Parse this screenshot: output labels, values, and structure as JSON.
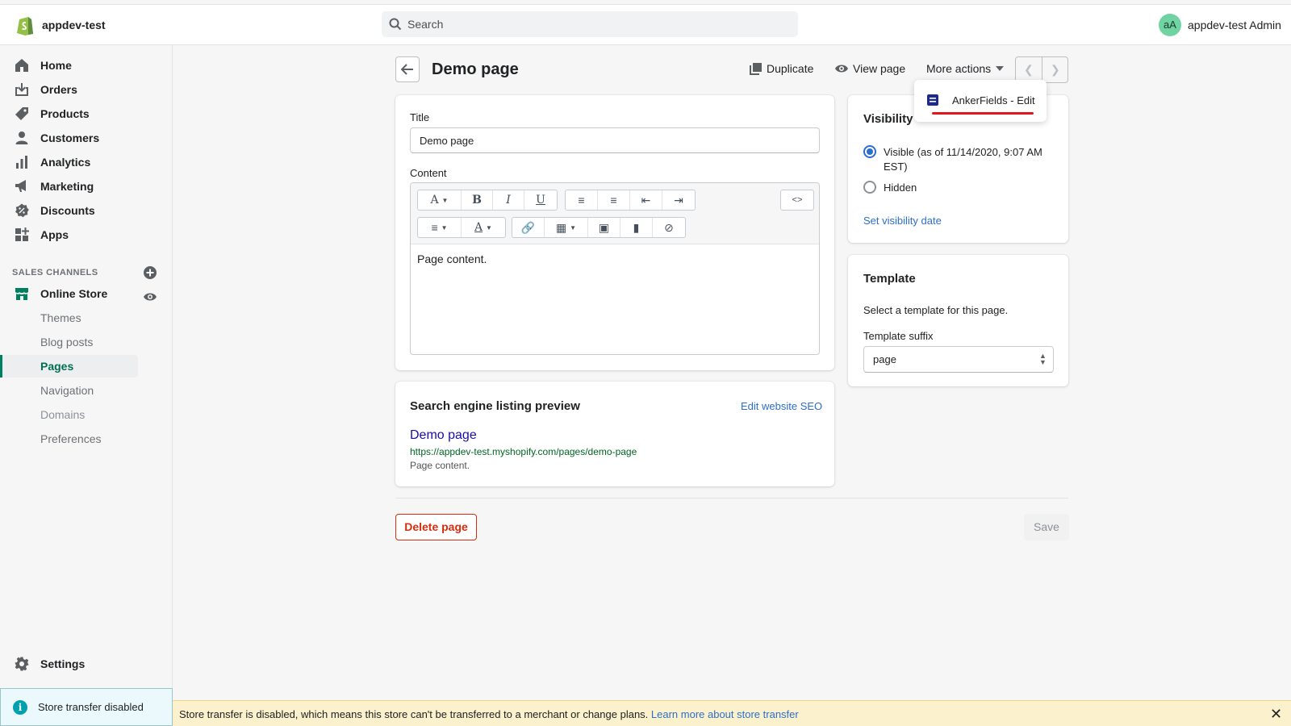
{
  "topbar": {
    "store_name": "appdev-test",
    "search_placeholder": "Search",
    "avatar_initials": "aA",
    "user_name": "appdev-test Admin"
  },
  "sidebar": {
    "main_items": [
      {
        "label": "Home",
        "icon": "home-icon"
      },
      {
        "label": "Orders",
        "icon": "orders-icon"
      },
      {
        "label": "Products",
        "icon": "tag-icon"
      },
      {
        "label": "Customers",
        "icon": "person-icon"
      },
      {
        "label": "Analytics",
        "icon": "bar-chart-icon"
      },
      {
        "label": "Marketing",
        "icon": "megaphone-icon"
      },
      {
        "label": "Discounts",
        "icon": "discount-icon"
      },
      {
        "label": "Apps",
        "icon": "apps-icon"
      }
    ],
    "sales_channels_title": "SALES CHANNELS",
    "online_store_label": "Online Store",
    "online_store_sub": [
      {
        "label": "Themes",
        "state": "normal"
      },
      {
        "label": "Blog posts",
        "state": "normal"
      },
      {
        "label": "Pages",
        "state": "active"
      },
      {
        "label": "Navigation",
        "state": "normal"
      },
      {
        "label": "Domains",
        "state": "disabled"
      },
      {
        "label": "Preferences",
        "state": "normal"
      }
    ],
    "settings_label": "Settings",
    "store_transfer_label": "Store transfer disabled"
  },
  "header": {
    "title": "Demo page",
    "duplicate_label": "Duplicate",
    "view_page_label": "View page",
    "more_actions_label": "More actions"
  },
  "dropdown": {
    "item_label": "AnkerFields - Edit"
  },
  "main_card": {
    "title_label": "Title",
    "title_value": "Demo page",
    "content_label": "Content",
    "editor_content": "Page content."
  },
  "seo": {
    "heading": "Search engine listing preview",
    "edit_link": "Edit website SEO",
    "preview_title": "Demo page",
    "preview_url": "https://appdev-test.myshopify.com/pages/demo-page",
    "preview_description": "Page content."
  },
  "visibility": {
    "heading": "Visibility",
    "visible_label_line1": "Visible (as of 11/14/2020, 9:07 AM",
    "visible_label_line2": "EST)",
    "hidden_label": "Hidden",
    "set_date_link": "Set visibility date",
    "selected": "visible"
  },
  "template": {
    "heading": "Template",
    "description": "Select a template for this page.",
    "suffix_label": "Template suffix",
    "suffix_value": "page"
  },
  "footer": {
    "delete_label": "Delete page",
    "save_label": "Save"
  },
  "banner": {
    "message": "Store transfer is disabled, which means this store can't be transferred to a merchant or change plans.",
    "link": "Learn more about store transfer",
    "close": "✕"
  },
  "colors": {
    "accent_green": "#008060",
    "link_blue": "#2c6ecb",
    "danger_red": "#d82c0d",
    "banner_yellow": "#fcf1cd"
  }
}
